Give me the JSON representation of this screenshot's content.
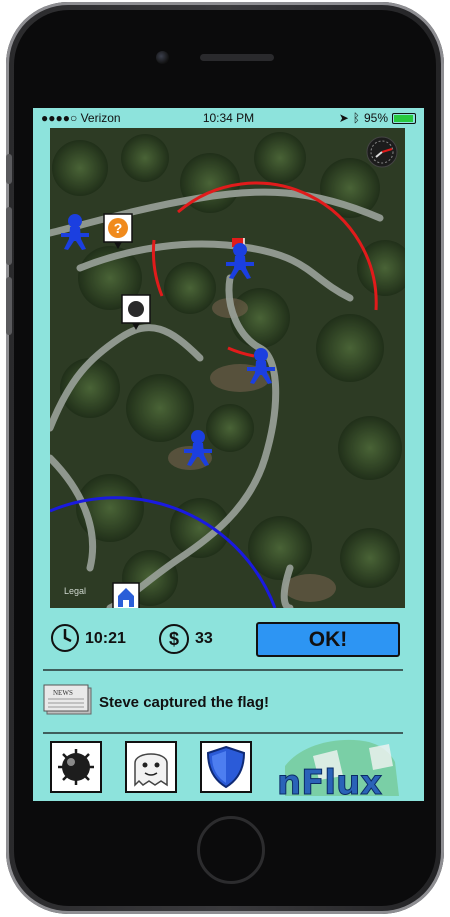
{
  "status_bar": {
    "carrier": "●●●●○ Verizon",
    "time": "10:34 PM",
    "battery_text": "95%",
    "battery_level": 0.95,
    "battery_color": "#27c93f"
  },
  "map": {
    "accent_red": "#e11b1b",
    "accent_blue": "#1a1ae0",
    "player_color": "#1b3fe0",
    "watermark": "Legal",
    "markers": [
      "question-marker",
      "mine-marker",
      "home-marker",
      "flag"
    ],
    "players_count": 4
  },
  "hud": {
    "time_value": "10:21",
    "coins_symbol": "$",
    "coins_value": "33",
    "ok_label": "OK!",
    "ok_color": "#2d95f3"
  },
  "news": {
    "icon_label": "NEWS",
    "message": "Steve captured the flag!"
  },
  "toolbar": {
    "items": [
      "mine-tool",
      "ghost-tool",
      "shield-tool"
    ]
  },
  "logo": {
    "text": "nFlux"
  },
  "colors": {
    "screen_bg": "#8de3dc"
  }
}
